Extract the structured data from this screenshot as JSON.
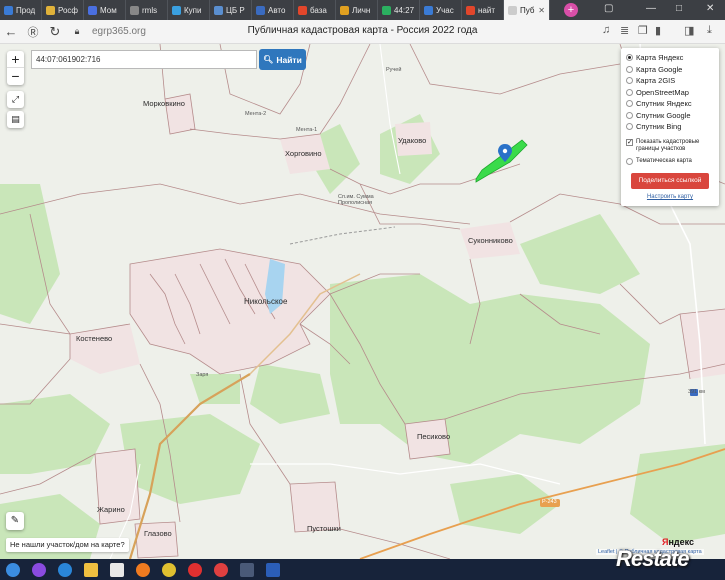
{
  "browser": {
    "tabs": [
      {
        "label": "Прод",
        "color": "#3a7bd5"
      },
      {
        "label": "Росф",
        "color": "#e0b23a"
      },
      {
        "label": "Мом",
        "color": "#4a6fe0"
      },
      {
        "label": "rmls",
        "color": "#888888"
      },
      {
        "label": "Купи",
        "color": "#3aa0e0"
      },
      {
        "label": "ЦБ Р",
        "color": "#5a8fd0"
      },
      {
        "label": "Авто",
        "color": "#3a6bc0"
      },
      {
        "label": "база",
        "color": "#e2462b"
      },
      {
        "label": "Личн",
        "color": "#e0a020"
      },
      {
        "label": "44:27",
        "color": "#2bb060"
      },
      {
        "label": "Учас",
        "color": "#3a7bd5"
      },
      {
        "label": "найт",
        "color": "#e2462b"
      },
      {
        "label": "Пуб",
        "color": "#cccccc"
      }
    ],
    "url": "egrp365.org",
    "page_title": "Публичная кадастровая карта - Россия 2022 года"
  },
  "map": {
    "search_value": "44:07:061902:716",
    "find_label": "Найти",
    "zoom_in": "+",
    "zoom_out": "−",
    "layers": [
      {
        "label": "Карта Яндекс",
        "selected": true
      },
      {
        "label": "Карта Google",
        "selected": false
      },
      {
        "label": "Карта 2GIS",
        "selected": false
      },
      {
        "label": "OpenStreetMap",
        "selected": false
      },
      {
        "label": "Спутник Яндекс",
        "selected": false
      },
      {
        "label": "Спутник Google",
        "selected": false
      },
      {
        "label": "Спутник Bing",
        "selected": false
      }
    ],
    "show_borders_label": "Показать кадастровые границы участков",
    "thematic_label": "Тематическая карта",
    "share_label": "Поделиться ссылкой",
    "setup_label": "Настроить карту",
    "not_found_label": "Не нашли участок/дом на карте?",
    "place_names": {
      "morkovkino": "Морковкино",
      "khorgovino": "Хорговино",
      "udakovo": "Удаково",
      "sukonnikovo": "Суконниково",
      "nikolskoe": "Никольское",
      "kostenevo": "Костенево",
      "pesikovo": "Песиково",
      "zharino": "Жарино",
      "glazovo": "Глазово",
      "pustoshki": "Пустошки",
      "ruchey": "Ручей",
      "menta1": "Мента-1",
      "menta2": "Мента-2",
      "zarya": "Заря",
      "km391": "391 км",
      "road_r": "Р-243",
      "school": "Сп.им. Сумма Прополисная"
    },
    "yandex_logo": {
      "letter": "Я",
      "rest": "ндекс"
    },
    "copyright": "Leaflet | © Публичная кадастровая карта"
  },
  "taskbar": {
    "icons": [
      {
        "name": "windows-start",
        "color": "#3b8de0"
      },
      {
        "name": "alice",
        "color": "#8a4be0"
      },
      {
        "name": "internet-explorer",
        "color": "#2a86d8"
      },
      {
        "name": "file-explorer",
        "color": "#f0c040"
      },
      {
        "name": "calendar",
        "color": "#e8e8e8"
      },
      {
        "name": "firefox",
        "color": "#f07b20"
      },
      {
        "name": "chrome",
        "color": "#e0c030"
      },
      {
        "name": "yandex-browser",
        "color": "#e03030"
      },
      {
        "name": "yandex",
        "color": "#e04040"
      },
      {
        "name": "app-window",
        "color": "#4a5a78"
      },
      {
        "name": "word",
        "color": "#2b5eb8"
      }
    ]
  },
  "watermark": {
    "text": "Restate"
  }
}
